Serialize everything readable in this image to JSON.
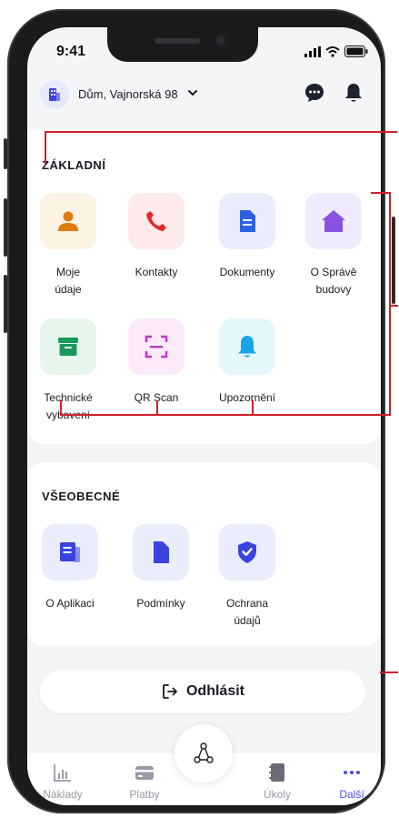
{
  "status_bar": {
    "time": "9:41"
  },
  "header": {
    "address": "Dům, Vajnorská 98"
  },
  "sections": {
    "basic": {
      "title": "ZÁKLADNÍ",
      "items": [
        {
          "label": "Moje\núdaje",
          "icon": "user-icon",
          "bg": "#fdf3e4",
          "color": "#e07a10"
        },
        {
          "label": "Kontakty",
          "icon": "phone-icon",
          "bg": "#fdeaea",
          "color": "#e02a2a"
        },
        {
          "label": "Dokumenty",
          "icon": "document-icon",
          "bg": "#eaeefc",
          "color": "#2e60e6"
        },
        {
          "label": "O Správě\nbudovy",
          "icon": "home-icon",
          "bg": "#f0ebfc",
          "color": "#8a52e0"
        },
        {
          "label": "Technické\nvybavení",
          "icon": "archive-icon",
          "bg": "#e6f6ec",
          "color": "#17995a"
        },
        {
          "label": "QR Scan",
          "icon": "qr-scan-icon",
          "bg": "#fbebfa",
          "color": "#c238c9"
        },
        {
          "label": "Upozornění",
          "icon": "bell-icon",
          "bg": "#e6f7fc",
          "color": "#18a6e6"
        }
      ]
    },
    "general": {
      "title": "VŠEOBECNÉ",
      "items": [
        {
          "label": "O Aplikaci",
          "icon": "app-info-icon",
          "bg": "#eaeefc",
          "color": "#3b43dd"
        },
        {
          "label": "Podmínky",
          "icon": "file-icon",
          "bg": "#eaeefc",
          "color": "#3b43dd"
        },
        {
          "label": "Ochrana\núdajů",
          "icon": "shield-check-icon",
          "bg": "#eaeefc",
          "color": "#3b43dd"
        }
      ]
    }
  },
  "logout": {
    "label": "Odhlásit"
  },
  "tabbar": {
    "tabs": [
      {
        "label": "Náklady",
        "icon": "chart-icon",
        "active": false
      },
      {
        "label": "Platby",
        "icon": "card-icon",
        "active": false
      },
      {
        "label": "Úkoly",
        "icon": "notebook-icon",
        "active": false
      },
      {
        "label": "Další",
        "icon": "more-icon",
        "active": true
      }
    ]
  },
  "colors": {
    "accent": "#4c4fe8",
    "annotation": "#d0202a",
    "background": "#f4f5f7"
  }
}
